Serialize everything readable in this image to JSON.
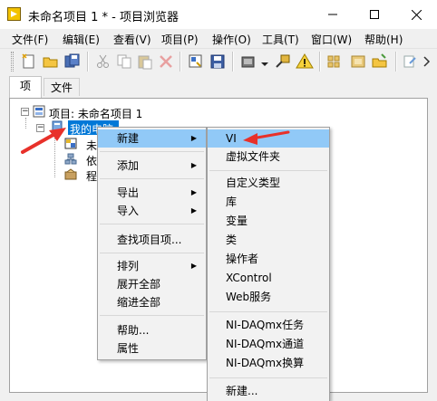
{
  "window": {
    "title": "未命名项目 1 * - 项目浏览器",
    "minimize_icon": "minimize-icon",
    "maximize_icon": "maximize-icon",
    "close_icon": "close-icon"
  },
  "menubar": {
    "items": [
      "文件(F)",
      "编辑(E)",
      "查看(V)",
      "项目(P)",
      "操作(O)",
      "工具(T)",
      "窗口(W)",
      "帮助(H)"
    ]
  },
  "toolbar": {
    "icons": [
      "new-icon",
      "open-icon",
      "save-all-icon",
      "cut-icon",
      "copy-icon",
      "paste-icon",
      "delete-icon",
      "vi-properties-icon",
      "save-icon",
      "build-icon",
      "dropdown-icon",
      "deploy-icon",
      "warning-icon",
      "filter-icon",
      "arrange-icon",
      "add-file-icon",
      "chevron-right-icon"
    ]
  },
  "tabs": [
    "项",
    "文件"
  ],
  "tree": {
    "root_label": "项目: 未命名项目 1",
    "selected_label": "我的电脑",
    "child_labels": [
      "未",
      "依",
      "程"
    ]
  },
  "context_menu": {
    "items": [
      {
        "label": "新建",
        "submenu": true
      },
      {
        "label": "添加",
        "submenu": true
      },
      {
        "label": "导出",
        "submenu": true
      },
      {
        "label": "导入",
        "submenu": true
      },
      {
        "label": "查找项目项...",
        "submenu": false
      },
      {
        "label": "排列",
        "submenu": true
      },
      {
        "label": "展开全部",
        "submenu": false
      },
      {
        "label": "缩进全部",
        "submenu": false
      },
      {
        "label": "帮助...",
        "submenu": false
      },
      {
        "label": "属性",
        "submenu": false
      }
    ]
  },
  "submenu": {
    "items": [
      "VI",
      "虚拟文件夹",
      "自定义类型",
      "库",
      "变量",
      "类",
      "操作者",
      "XControl",
      "Web服务",
      "NI-DAQmx任务",
      "NI-DAQmx通道",
      "NI-DAQmx换算",
      "新建..."
    ]
  },
  "colors": {
    "highlight": "#91c9f7",
    "selection": "#0078d7",
    "annotation_arrow": "#e8312a"
  }
}
